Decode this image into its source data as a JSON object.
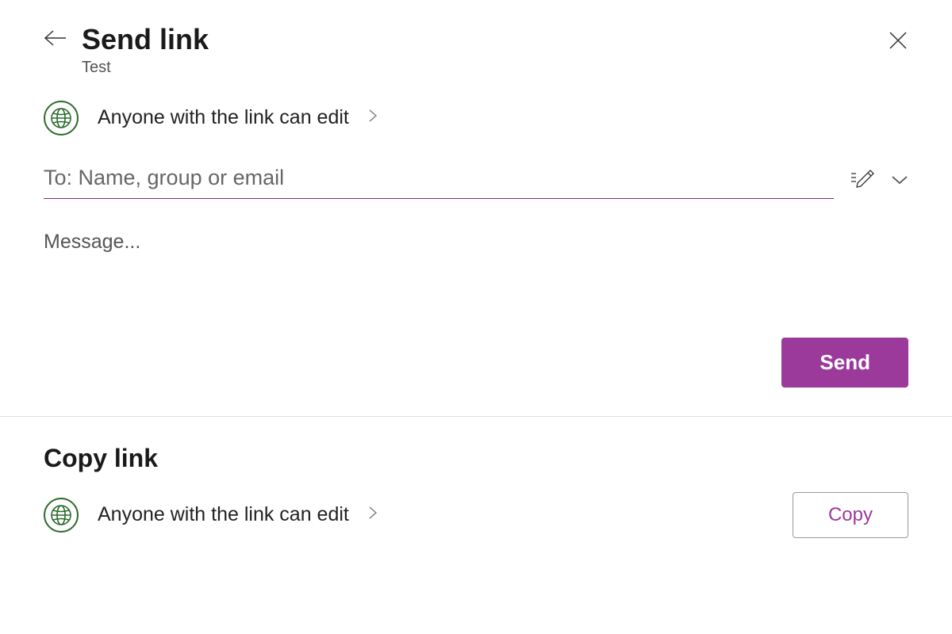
{
  "header": {
    "title": "Send link",
    "subtitle": "Test"
  },
  "permissions": {
    "text": "Anyone with the link can edit"
  },
  "recipients": {
    "placeholder": "To: Name, group or email",
    "value": ""
  },
  "message": {
    "placeholder": "Message...",
    "value": ""
  },
  "actions": {
    "send_label": "Send",
    "copy_label": "Copy"
  },
  "copy_section": {
    "title": "Copy link",
    "perm_text": "Anyone with the link can edit"
  },
  "colors": {
    "accent": "#9b3a9b",
    "globe": "#2a6b2a",
    "underline": "#7a2a7a"
  }
}
